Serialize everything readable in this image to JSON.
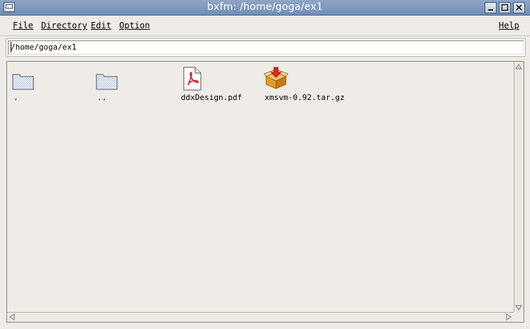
{
  "window": {
    "title": "bxfm: /home/goga/ex1"
  },
  "menu": {
    "file": "File",
    "directory": "Directory",
    "edit": "Edit",
    "option": "Option",
    "help": "Help"
  },
  "path": {
    "value": "/home/goga/ex1"
  },
  "files": [
    {
      "name": ".",
      "icon": "folder-icon"
    },
    {
      "name": "..",
      "icon": "folder-icon"
    },
    {
      "name": "ddxDesign.pdf",
      "icon": "pdf-file-icon"
    },
    {
      "name": "xmsvm-0.92.tar.gz",
      "icon": "archive-package-icon"
    }
  ]
}
